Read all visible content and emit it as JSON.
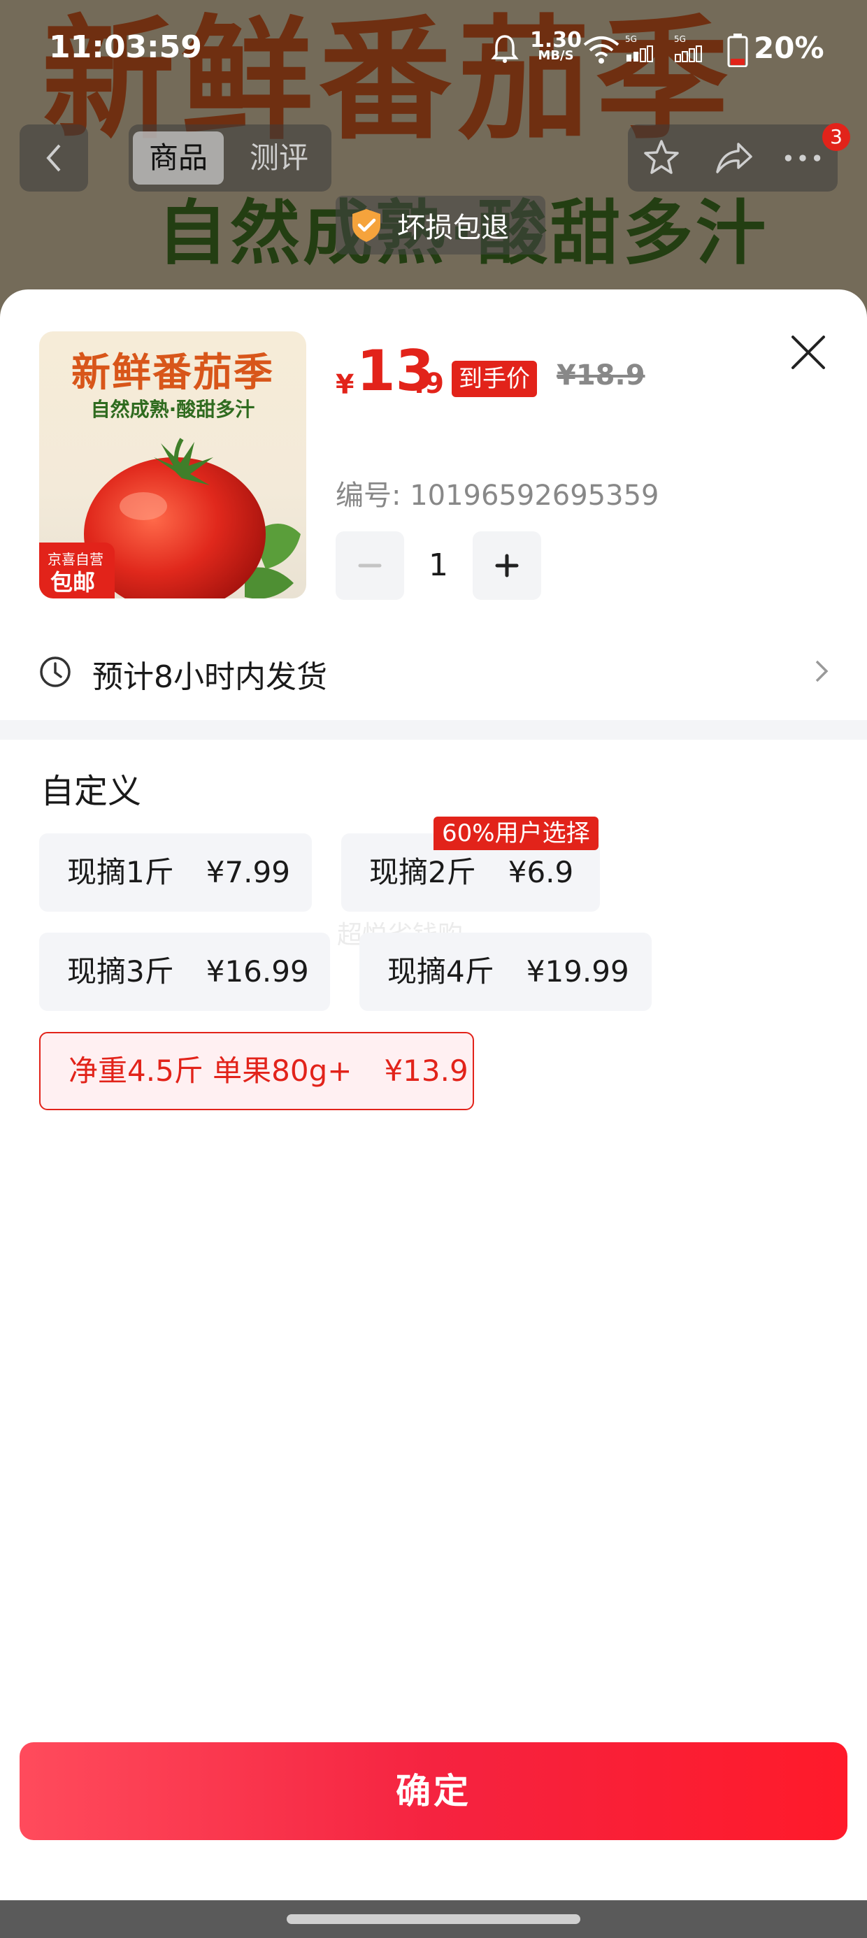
{
  "status_bar": {
    "time": "11:03:59",
    "network_speed": "1.30",
    "network_speed_unit": "MB/S",
    "battery": "20%"
  },
  "background": {
    "banner_title": "新鲜番茄季",
    "banner_subtitle": "自然成熟·酸甜多汁"
  },
  "top_nav": {
    "tabs": [
      {
        "label": "商品",
        "active": true
      },
      {
        "label": "测评",
        "active": false
      }
    ],
    "badge_count": "3",
    "icons": [
      "back-arrow-icon",
      "star-icon",
      "share-icon",
      "more-icon"
    ]
  },
  "guarantee": {
    "label": "坏损包退",
    "icon": "shield-check-icon"
  },
  "product": {
    "image": {
      "title": "新鲜番茄季",
      "subtitle": "自然成熟·酸甜多汁",
      "tag_top": "京喜自营",
      "tag_bottom": "包邮"
    },
    "price_currency": "¥",
    "price_int": "13",
    "price_dec": ".9",
    "price_label": "到手价",
    "original_price": "¥18.9",
    "sku": "编号: 10196592695359",
    "quantity": "1"
  },
  "delivery": {
    "text": "预计8小时内发货",
    "icon": "clock-icon"
  },
  "options": {
    "section_title": "自定义",
    "popular_badge": "60%用户选择",
    "watermark": "超悦省钱购",
    "items": [
      {
        "name": "现摘1斤",
        "price": "¥7.99",
        "selected": false
      },
      {
        "name": "现摘2斤",
        "price": "¥6.9",
        "selected": false
      },
      {
        "name": "现摘3斤",
        "price": "¥16.99",
        "selected": false
      },
      {
        "name": "现摘4斤",
        "price": "¥19.99",
        "selected": false
      },
      {
        "name": "净重4.5斤 单果80g+",
        "price": "¥13.9",
        "selected": true
      }
    ]
  },
  "actions": {
    "confirm_label": "确定"
  },
  "colors": {
    "accent": "#e2231a",
    "confirm_gradient_start": "#ff4b5c",
    "confirm_gradient_end": "#ff1a2a"
  }
}
